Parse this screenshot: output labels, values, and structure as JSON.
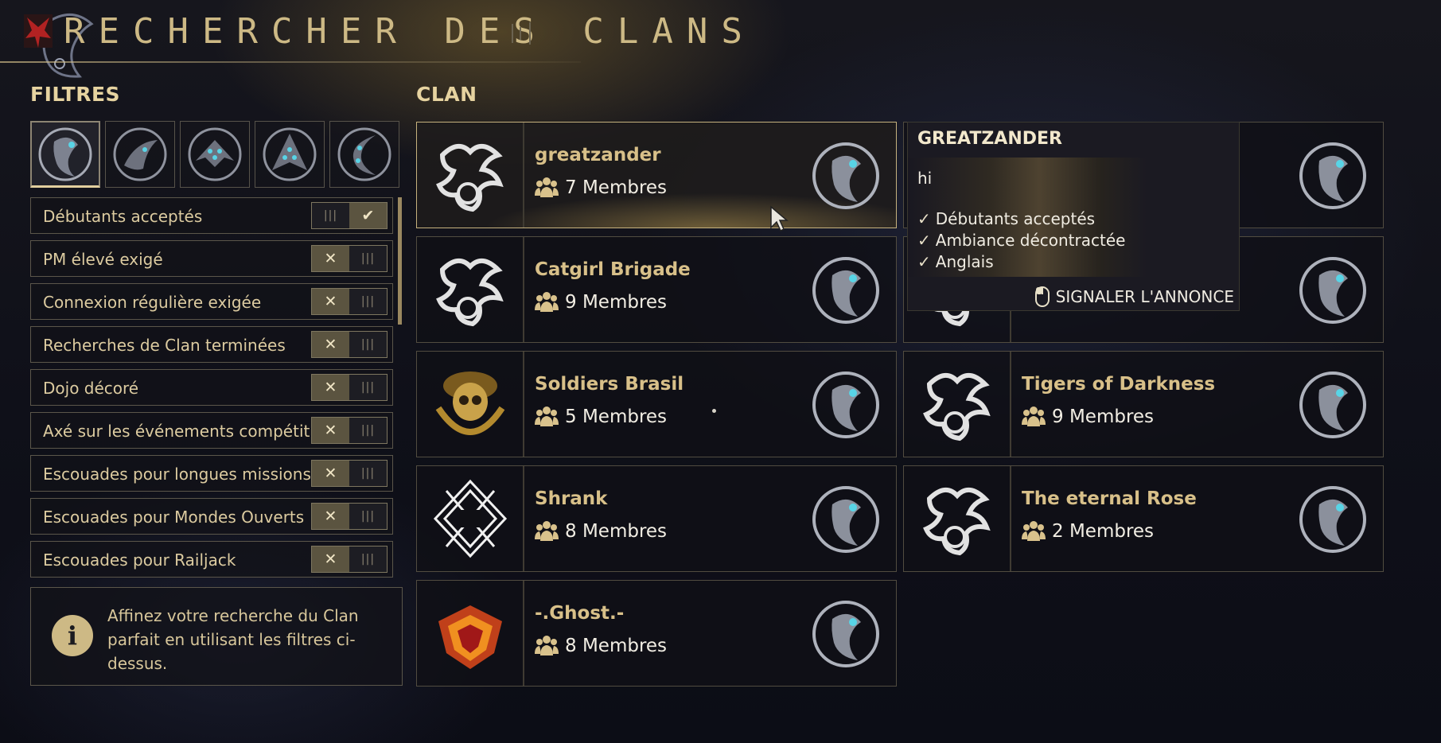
{
  "header": {
    "title": "RECHERCHER DES CLANS"
  },
  "filters": {
    "label": "FILTRES",
    "tabs": [
      {
        "icon": "storm-sigil-icon"
      },
      {
        "icon": "moon-sigil-icon"
      },
      {
        "icon": "mountain-sigil-icon"
      },
      {
        "icon": "ghost-sigil-icon"
      },
      {
        "icon": "shadow-sigil-icon"
      }
    ],
    "options": [
      {
        "label": "Débutants acceptés",
        "state": "on"
      },
      {
        "label": "PM élevé exigé",
        "state": "off"
      },
      {
        "label": "Connexion régulière exigée",
        "state": "off"
      },
      {
        "label": "Recherches de Clan terminées",
        "state": "off"
      },
      {
        "label": "Dojo décoré",
        "state": "off"
      },
      {
        "label": "Axé sur les événements compétitifs",
        "state": "off"
      },
      {
        "label": "Escouades pour longues missions",
        "state": "off"
      },
      {
        "label": "Escouades pour Mondes Ouverts",
        "state": "off"
      },
      {
        "label": "Escouades pour Railjack",
        "state": "off"
      }
    ],
    "info": "Affinez votre recherche du Clan parfait en utilisant les filtres ci-dessus."
  },
  "clan": {
    "label": "CLAN",
    "cards": [
      {
        "name": "greatzander",
        "members": "7 Membres",
        "selected": true,
        "logo": "lotus-logo"
      },
      {
        "name": "",
        "members": "",
        "selected": false,
        "logo": "lotus-logo"
      },
      {
        "name": "Catgirl Brigade",
        "members": "9 Membres",
        "selected": false,
        "logo": "lotus-logo"
      },
      {
        "name": "",
        "members": "",
        "selected": false,
        "logo": "lotus-logo"
      },
      {
        "name": "Soldiers Brasil",
        "members": "5 Membres",
        "selected": false,
        "logo": "skull-logo"
      },
      {
        "name": "Tigers of Darkness",
        "members": "9 Membres",
        "selected": false,
        "logo": "lotus-logo"
      },
      {
        "name": "Shrank",
        "members": "8 Membres",
        "selected": false,
        "logo": "diamond-logo"
      },
      {
        "name": "The eternal Rose",
        "members": "2 Membres",
        "selected": false,
        "logo": "lotus-logo"
      },
      {
        "name": "-.Ghost.-",
        "members": "8 Membres",
        "selected": false,
        "logo": "flame-logo"
      }
    ]
  },
  "tooltip": {
    "title": "GREATZANDER",
    "message": "hi",
    "tags": [
      "Débutants acceptés",
      "Ambiance décontractée",
      "Anglais"
    ],
    "report": "SIGNALER L'ANNONCE"
  },
  "colors": {
    "accent": "#d9c28c",
    "background": "#11121a",
    "border": "#514c40"
  }
}
